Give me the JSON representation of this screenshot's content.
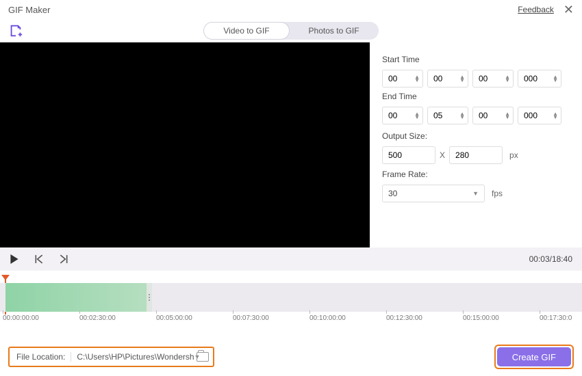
{
  "window": {
    "title": "GIF Maker",
    "feedback": "Feedback"
  },
  "modes": {
    "video": "Video to GIF",
    "photos": "Photos to GIF"
  },
  "side": {
    "start_label": "Start Time",
    "end_label": "End Time",
    "start": {
      "h": "00",
      "m": "00",
      "s": "00",
      "ms": "000"
    },
    "end": {
      "h": "00",
      "m": "05",
      "s": "00",
      "ms": "000"
    },
    "output_label": "Output Size:",
    "width": "500",
    "height": "280",
    "px": "px",
    "frame_label": "Frame Rate:",
    "fps_value": "30",
    "fps": "fps"
  },
  "controls": {
    "time": "00:03/18:40"
  },
  "ticks": [
    "00:00:00:00",
    "00:02:30:00",
    "00:05:00:00",
    "00:07:30:00",
    "00:10:00:00",
    "00:12:30:00",
    "00:15:00:00",
    "00:17:30:0"
  ],
  "bottom": {
    "file_label": "File Location:",
    "path": "C:\\Users\\HP\\Pictures\\Wondersh",
    "create": "Create GIF"
  }
}
